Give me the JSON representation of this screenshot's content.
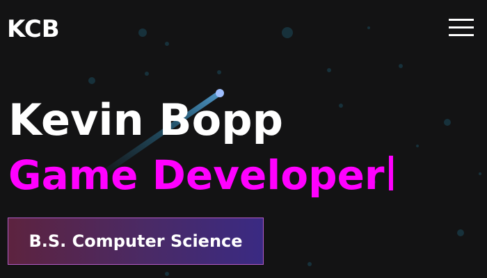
{
  "header": {
    "logo": "KCB",
    "menu_icon": "hamburger-menu-icon"
  },
  "hero": {
    "name": "Kevin Bopp",
    "role": "Game Developer",
    "degree": "B.S. Computer Science"
  },
  "colors": {
    "background": "#131314",
    "accent": "#ff00ff",
    "text": "#ffffff",
    "particle": "#17313b",
    "meteor_head": "#9fbfff"
  }
}
